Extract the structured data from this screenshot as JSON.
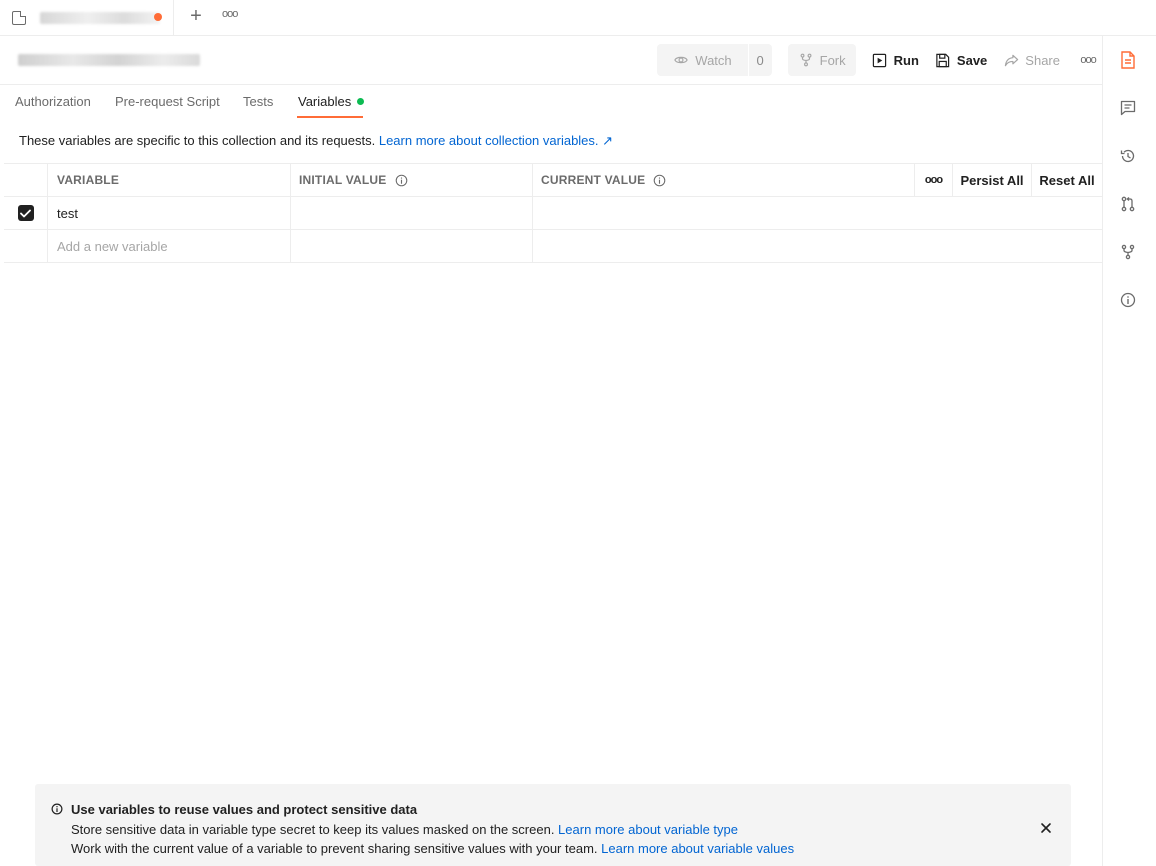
{
  "tabstrip": {
    "add_label": "+",
    "more_label": "ooo"
  },
  "toolbar": {
    "watch_label": "Watch",
    "watch_count": "0",
    "fork_label": "Fork",
    "run_label": "Run",
    "save_label": "Save",
    "share_label": "Share",
    "more_label": "ooo"
  },
  "subtabs": [
    {
      "label": "Authorization"
    },
    {
      "label": "Pre-request Script"
    },
    {
      "label": "Tests"
    },
    {
      "label": "Variables"
    }
  ],
  "description": {
    "text": "These variables are specific to this collection and its requests. ",
    "link": "Learn more about collection variables. ↗"
  },
  "table": {
    "headers": {
      "variable": "VARIABLE",
      "initial": "INITIAL VALUE",
      "current": "CURRENT VALUE",
      "more": "ooo",
      "persist_all": "Persist All",
      "reset_all": "Reset All"
    },
    "rows": [
      {
        "variable": "test",
        "initial": "",
        "current": "",
        "checked": true
      }
    ],
    "new_placeholder": "Add a new variable"
  },
  "rail": {
    "icons": [
      "documentation-icon",
      "comments-icon",
      "history-icon",
      "pull-request-icon",
      "fork-icon",
      "info-icon"
    ],
    "active_color": "#ff6c37"
  },
  "banner": {
    "title": "Use variables to reuse values and protect sensitive data",
    "line1_text": "Store sensitive data in variable type secret to keep its values masked on the screen. ",
    "line1_link": "Learn more about variable type",
    "line2_text": "Work with the current value of a variable to prevent sharing sensitive values with your team. ",
    "line2_link": "Learn more about variable values"
  },
  "colors": {
    "accent": "#ff6c37",
    "link": "#0265d2",
    "status_green": "#0cbb52"
  }
}
